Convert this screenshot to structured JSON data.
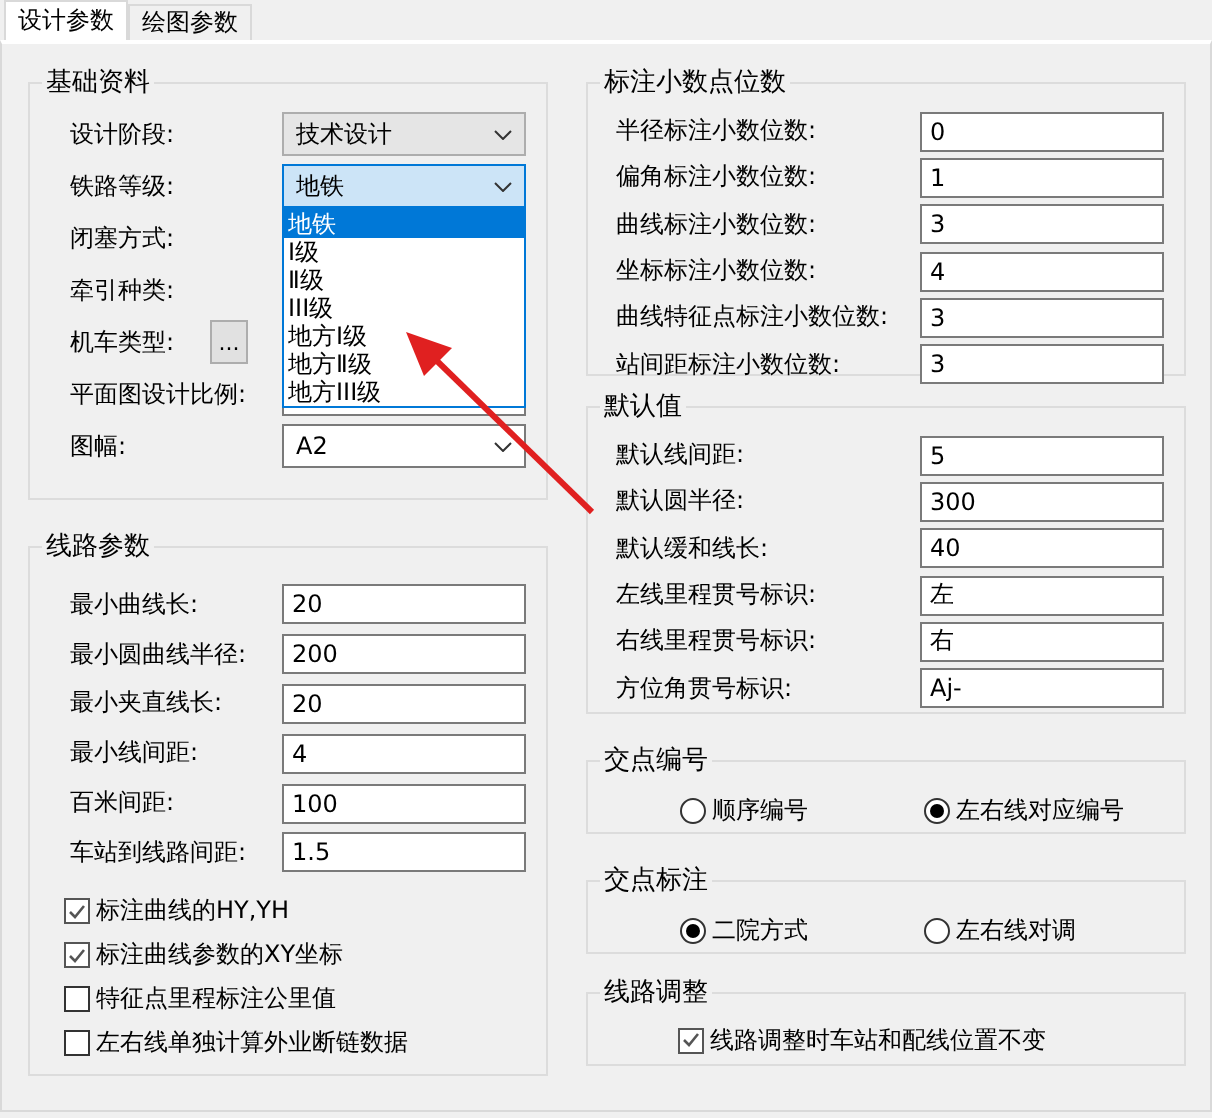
{
  "tabs": [
    {
      "label": "设计参数",
      "selected": true
    },
    {
      "label": "绘图参数",
      "selected": false
    }
  ],
  "basic": {
    "title": "基础资料",
    "rows": [
      {
        "kind": "combo",
        "label": "设计阶段:",
        "value": "技术设计",
        "focused": false
      },
      {
        "kind": "combo",
        "label": "铁路等级:",
        "value": "地铁",
        "focused": true,
        "options": [
          {
            "label": "地铁",
            "selected": true
          },
          {
            "label": "Ⅰ级",
            "selected": false
          },
          {
            "label": "Ⅱ级",
            "selected": false
          },
          {
            "label": "III级",
            "selected": false
          },
          {
            "label": "地方Ⅰ级",
            "selected": false
          },
          {
            "label": "地方Ⅱ级",
            "selected": false
          },
          {
            "label": "地方III级",
            "selected": false
          }
        ]
      },
      {
        "kind": "covered",
        "label": "闭塞方式:"
      },
      {
        "kind": "covered",
        "label": "牵引种类:"
      },
      {
        "kind": "browse",
        "label": "机车类型:",
        "button": "..."
      },
      {
        "kind": "editcombo",
        "label": "平面图设计比例:"
      },
      {
        "kind": "editcombo",
        "label": "图幅:",
        "value": "A2"
      }
    ]
  },
  "line_params": {
    "title": "线路参数",
    "fields": [
      {
        "label": "最小曲线长:",
        "value": "20"
      },
      {
        "label": "最小圆曲线半径:",
        "value": "200"
      },
      {
        "label": "最小夹直线长:",
        "value": "20"
      },
      {
        "label": "最小线间距:",
        "value": "4"
      },
      {
        "label": "百米间距:",
        "value": "100"
      },
      {
        "label": "车站到线路间距:",
        "value": "1.5"
      }
    ],
    "checkboxes": [
      {
        "label": "标注曲线的HY,YH",
        "checked": true
      },
      {
        "label": "标注曲线参数的XY坐标",
        "checked": true
      },
      {
        "label": "特征点里程标注公里值",
        "checked": false
      },
      {
        "label": "左右线单独计算外业断链数据",
        "checked": false
      }
    ]
  },
  "decimals": {
    "title": "标注小数点位数",
    "fields": [
      {
        "label": "半径标注小数位数:",
        "value": "0"
      },
      {
        "label": "偏角标注小数位数:",
        "value": "1"
      },
      {
        "label": "曲线标注小数位数:",
        "value": "3"
      },
      {
        "label": "坐标标注小数位数:",
        "value": "4"
      },
      {
        "label": "曲线特征点标注小数位数:",
        "value": "3"
      },
      {
        "label": "站间距标注小数位数:",
        "value": "3"
      }
    ]
  },
  "defaults": {
    "title": "默认值",
    "fields": [
      {
        "label": "默认线间距:",
        "value": "5"
      },
      {
        "label": "默认圆半径:",
        "value": "300"
      },
      {
        "label": "默认缓和线长:",
        "value": "40"
      },
      {
        "label": "左线里程贯号标识:",
        "value": "左"
      },
      {
        "label": "右线里程贯号标识:",
        "value": "右"
      },
      {
        "label": "方位角贯号标识:",
        "value": "Aj-"
      }
    ]
  },
  "vertex_numbering": {
    "title": "交点编号",
    "options": [
      {
        "label": "顺序编号",
        "selected": false
      },
      {
        "label": "左右线对应编号",
        "selected": true
      }
    ]
  },
  "vertex_labeling": {
    "title": "交点标注",
    "options": [
      {
        "label": "二院方式",
        "selected": true
      },
      {
        "label": "左右线对调",
        "selected": false
      }
    ]
  },
  "route_adjust": {
    "title": "线路调整",
    "checkbox": {
      "label": "线路调整时车站和配线位置不变",
      "checked": true
    }
  }
}
